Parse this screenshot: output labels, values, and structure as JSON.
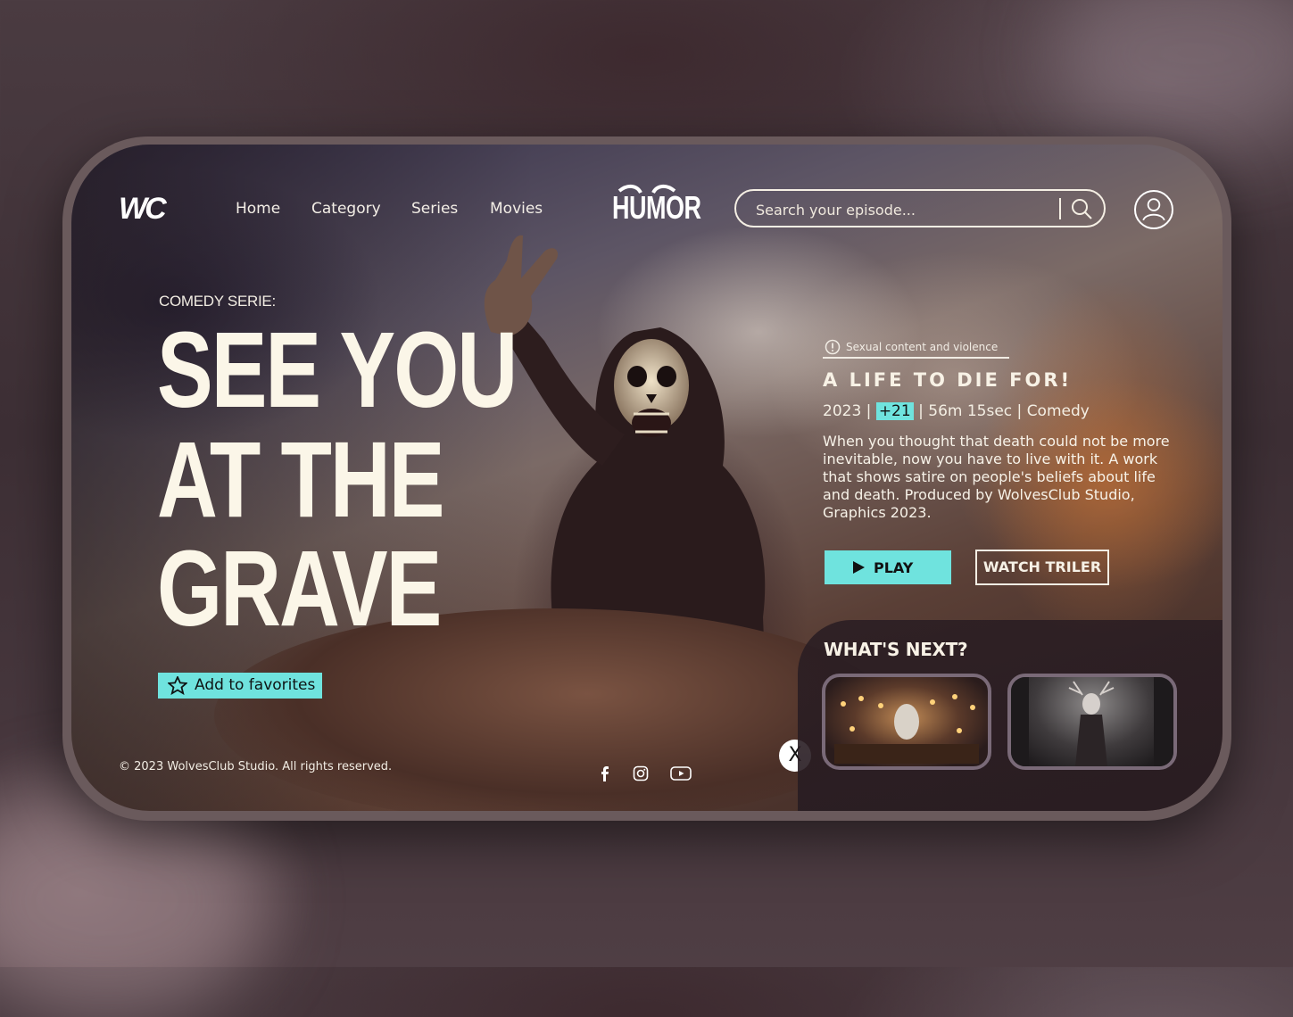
{
  "nav": {
    "logo": "WC",
    "links": [
      "Home",
      "Category",
      "Series",
      "Movies"
    ],
    "brand": "HUMOR",
    "search_placeholder": "Search your episode..."
  },
  "hero": {
    "kicker": "COMEDY SERIE:",
    "title_lines": [
      "SEE YOU",
      "AT THE",
      "GRAVE"
    ],
    "favorites_label": "Add to favorites"
  },
  "episode": {
    "warning": "Sexual content and violence",
    "title": "A LIFE TO DIE FOR!",
    "year": "2023",
    "rating": "+21",
    "duration": "56m 15sec",
    "genre": "Comedy",
    "description": "When you thought that death could not be more inevitable, now you have to live with it. A work that shows satire on people's beliefs about life and death. Produced by WolvesClub Studio, Graphics 2023.",
    "play_label": "PLAY",
    "trailer_label": "WATCH TRILER"
  },
  "next": {
    "heading": "WHAT'S NEXT?"
  },
  "footer": {
    "copyright": "© 2023 WolvesClub Studio. All rights reserved.",
    "close_label": "X"
  },
  "colors": {
    "accent": "#6fe3de",
    "text": "#f4efe4"
  }
}
